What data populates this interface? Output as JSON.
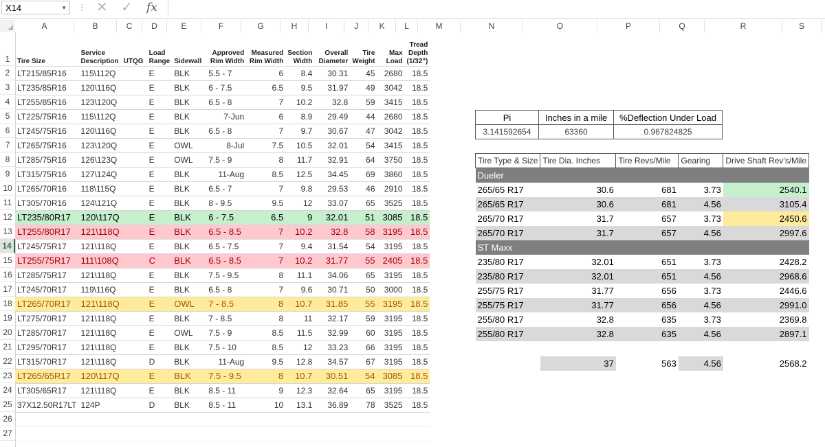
{
  "formula_bar": {
    "name_box": "X14",
    "fx_label": "fx",
    "formula_value": ""
  },
  "columns": [
    "A",
    "B",
    "C",
    "D",
    "E",
    "F",
    "G",
    "H",
    "I",
    "J",
    "K",
    "L",
    "M",
    "N",
    "O",
    "P",
    "Q",
    "R",
    "S"
  ],
  "rows": [
    "1",
    "2",
    "3",
    "4",
    "5",
    "6",
    "7",
    "8",
    "9",
    "10",
    "11",
    "12",
    "13",
    "14",
    "15",
    "16",
    "17",
    "18",
    "19",
    "20",
    "21",
    "22",
    "23",
    "24",
    "25",
    "26",
    "27"
  ],
  "selected_row": "14",
  "tires": {
    "headers": [
      "Tire Size",
      "Service Description",
      "UTQG",
      "Load Range",
      "Sidewall",
      "Approved Rim Width",
      "Measured Rim Width",
      "Section Width",
      "Overall Diameter",
      "Tire Weight",
      "Max Load",
      "Tread Depth (1/32\")"
    ],
    "rows": [
      {
        "style": "",
        "cells": [
          "LT215/85R16",
          "115\\112Q",
          "",
          "E",
          "BLK",
          "5.5 - 7",
          "6",
          "8.4",
          "30.31",
          "45",
          "2680",
          "18.5"
        ]
      },
      {
        "style": "",
        "cells": [
          "LT235/85R16",
          "120\\116Q",
          "",
          "E",
          "BLK",
          "6 - 7.5",
          "6.5",
          "9.5",
          "31.97",
          "49",
          "3042",
          "18.5"
        ]
      },
      {
        "style": "",
        "cells": [
          "LT255/85R16",
          "123\\120Q",
          "",
          "E",
          "BLK",
          "6.5 - 8",
          "7",
          "10.2",
          "32.8",
          "59",
          "3415",
          "18.5"
        ]
      },
      {
        "style": "",
        "cells": [
          "LT225/75R16",
          "115\\112Q",
          "",
          "E",
          "BLK",
          "7-Jun",
          "6",
          "8.9",
          "29.49",
          "44",
          "2680",
          "18.5"
        ]
      },
      {
        "style": "",
        "cells": [
          "LT245/75R16",
          "120\\116Q",
          "",
          "E",
          "BLK",
          "6.5 - 8",
          "7",
          "9.7",
          "30.67",
          "47",
          "3042",
          "18.5"
        ]
      },
      {
        "style": "",
        "cells": [
          "LT265/75R16",
          "123\\120Q",
          "",
          "E",
          "OWL",
          "8-Jul",
          "7.5",
          "10.5",
          "32.01",
          "54",
          "3415",
          "18.5"
        ]
      },
      {
        "style": "",
        "cells": [
          "LT285/75R16",
          "126\\123Q",
          "",
          "E",
          "OWL",
          "7.5 - 9",
          "8",
          "11.7",
          "32.91",
          "64",
          "3750",
          "18.5"
        ]
      },
      {
        "style": "",
        "cells": [
          "LT315/75R16",
          "127\\124Q",
          "",
          "E",
          "BLK",
          "11-Aug",
          "8.5",
          "12.5",
          "34.45",
          "69",
          "3860",
          "18.5"
        ]
      },
      {
        "style": "",
        "cells": [
          "LT265/70R16",
          "118\\115Q",
          "",
          "E",
          "BLK",
          "6.5 - 7",
          "7",
          "9.8",
          "29.53",
          "46",
          "2910",
          "18.5"
        ]
      },
      {
        "style": "",
        "cells": [
          "LT305/70R16",
          "124\\121Q",
          "",
          "E",
          "BLK",
          "8 - 9.5",
          "9.5",
          "12",
          "33.07",
          "65",
          "3525",
          "18.5"
        ]
      },
      {
        "style": "green",
        "cells": [
          "LT235/80R17",
          "120\\117Q",
          "",
          "E",
          "BLK",
          "6 - 7.5",
          "6.5",
          "9",
          "32.01",
          "51",
          "3085",
          "18.5"
        ]
      },
      {
        "style": "red",
        "cells": [
          "LT255/80R17",
          "121\\118Q",
          "",
          "E",
          "BLK",
          "6.5 - 8.5",
          "7",
          "10.2",
          "32.8",
          "58",
          "3195",
          "18.5"
        ]
      },
      {
        "style": "",
        "cells": [
          "LT245/75R17",
          "121\\118Q",
          "",
          "E",
          "BLK",
          "6.5 - 7.5",
          "7",
          "9.4",
          "31.54",
          "54",
          "3195",
          "18.5"
        ]
      },
      {
        "style": "red",
        "cells": [
          "LT255/75R17",
          "111\\108Q",
          "",
          "C",
          "BLK",
          "6.5 - 8.5",
          "7",
          "10.2",
          "31.77",
          "55",
          "2405",
          "18.5"
        ]
      },
      {
        "style": "",
        "cells": [
          "LT285/75R17",
          "121\\118Q",
          "",
          "E",
          "BLK",
          "7.5 - 9.5",
          "8",
          "11.1",
          "34.06",
          "65",
          "3195",
          "18.5"
        ]
      },
      {
        "style": "",
        "cells": [
          "LT245/70R17",
          "119\\116Q",
          "",
          "E",
          "BLK",
          "6.5 - 8",
          "7",
          "9.6",
          "30.71",
          "50",
          "3000",
          "18.5"
        ]
      },
      {
        "style": "yellow",
        "cells": [
          "LT265/70R17",
          "121\\118Q",
          "",
          "E",
          "OWL",
          "7 - 8.5",
          "8",
          "10.7",
          "31.85",
          "55",
          "3195",
          "18.5"
        ]
      },
      {
        "style": "",
        "cells": [
          "LT275/70R17",
          "121\\118Q",
          "",
          "E",
          "BLK",
          "7 - 8.5",
          "8",
          "11",
          "32.17",
          "59",
          "3195",
          "18.5"
        ]
      },
      {
        "style": "",
        "cells": [
          "LT285/70R17",
          "121\\118Q",
          "",
          "E",
          "OWL",
          "7.5 - 9",
          "8.5",
          "11.5",
          "32.99",
          "60",
          "3195",
          "18.5"
        ]
      },
      {
        "style": "",
        "cells": [
          "LT295/70R17",
          "121\\118Q",
          "",
          "E",
          "BLK",
          "7.5 - 10",
          "8.5",
          "12",
          "33.23",
          "66",
          "3195",
          "18.5"
        ]
      },
      {
        "style": "",
        "cells": [
          "LT315/70R17",
          "121\\118Q",
          "",
          "D",
          "BLK",
          "11-Aug",
          "9.5",
          "12.8",
          "34.57",
          "67",
          "3195",
          "18.5"
        ]
      },
      {
        "style": "yellow",
        "cells": [
          "LT265/65R17",
          "120\\117Q",
          "",
          "E",
          "BLK",
          "7.5 - 9.5",
          "8",
          "10.7",
          "30.51",
          "54",
          "3085",
          "18.5"
        ]
      },
      {
        "style": "",
        "cells": [
          "LT305/65R17",
          "121\\118Q",
          "",
          "E",
          "BLK",
          "8.5 - 11",
          "9",
          "12.3",
          "32.64",
          "65",
          "3195",
          "18.5"
        ]
      },
      {
        "style": "",
        "cells": [
          "37X12.50R17LT",
          "124P",
          "",
          "D",
          "BLK",
          "8.5 - 11",
          "10",
          "13.1",
          "36.89",
          "78",
          "3525",
          "18.5"
        ]
      }
    ]
  },
  "constants": {
    "headers": [
      "Pi",
      "Inches in a mile",
      "%Deflection Under Load"
    ],
    "values": [
      "3.141592654",
      "63360",
      "0.967824825"
    ]
  },
  "calc": {
    "headers": [
      "Tire Type & Size",
      "Tire Dia. Inches",
      "Tire Revs/Mile",
      "Gearing",
      "Drive Shaft Rev's/Mile"
    ],
    "groups": [
      {
        "name": "Dueler",
        "rows": [
          [
            "265/65 R17",
            "30.6",
            "681",
            "3.73",
            "2540.1"
          ],
          [
            "265/65 R17",
            "30.6",
            "681",
            "4.56",
            "3105.4"
          ],
          [
            "265/70 R17",
            "31.7",
            "657",
            "3.73",
            "2450.6"
          ],
          [
            "265/70 R17",
            "31.7",
            "657",
            "4.56",
            "2997.6"
          ]
        ]
      },
      {
        "name": "ST Maxx",
        "rows": [
          [
            "235/80 R17",
            "32.01",
            "651",
            "3.73",
            "2428.2"
          ],
          [
            "235/80 R17",
            "32.01",
            "651",
            "4.56",
            "2968.6"
          ],
          [
            "255/75 R17",
            "31.77",
            "656",
            "3.73",
            "2446.6"
          ],
          [
            "255/75 R17",
            "31.77",
            "656",
            "4.56",
            "2991.0"
          ],
          [
            "255/80 R17",
            "32.8",
            "635",
            "3.73",
            "2369.8"
          ],
          [
            "255/80 R17",
            "32.8",
            "635",
            "4.56",
            "2897.1"
          ]
        ]
      }
    ],
    "extra_row": [
      "",
      "37",
      "563",
      "4.56",
      "2568.2"
    ]
  }
}
